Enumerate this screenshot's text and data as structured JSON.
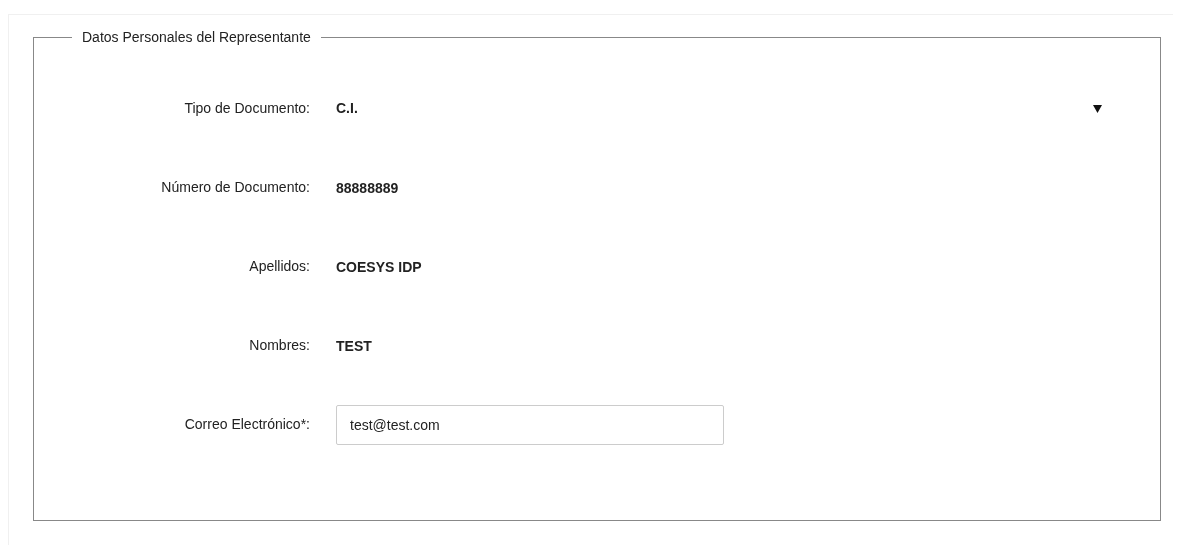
{
  "section": {
    "title": "Datos Personales del Representante",
    "fields": [
      {
        "kind": "select",
        "label": "Tipo de Documento:",
        "value": "C.I."
      },
      {
        "kind": "text",
        "label": "Número de Documento:",
        "value": "88888889"
      },
      {
        "kind": "text",
        "label": "Apellidos:",
        "value": "COESYS IDP"
      },
      {
        "kind": "text",
        "label": "Nombres:",
        "value": "TEST"
      },
      {
        "kind": "input",
        "label": "Correo Electrónico*:",
        "value": "test@test.com"
      }
    ]
  }
}
